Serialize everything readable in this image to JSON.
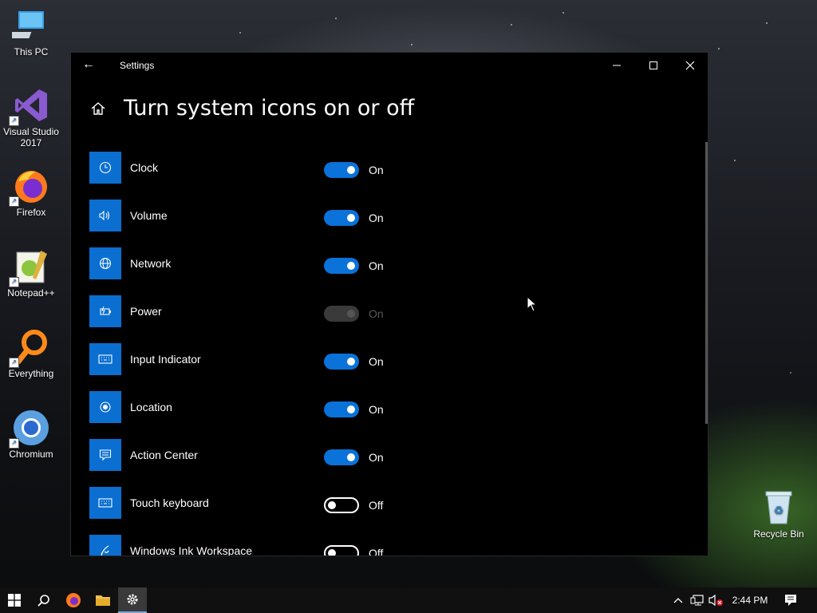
{
  "desktop": {
    "icons": [
      {
        "label": "This PC",
        "icon": "this-pc-icon"
      },
      {
        "label": "Visual Studio 2017",
        "icon": "visual-studio-icon"
      },
      {
        "label": "Firefox",
        "icon": "firefox-icon"
      },
      {
        "label": "Notepad++",
        "icon": "notepad-plus-plus-icon"
      },
      {
        "label": "Everything",
        "icon": "everything-search-icon"
      },
      {
        "label": "Chromium",
        "icon": "chromium-icon"
      }
    ],
    "recycle_bin": {
      "label": "Recycle Bin",
      "icon": "recycle-bin-icon"
    }
  },
  "window": {
    "title": "Settings",
    "page_title": "Turn system icons on or off",
    "settings": [
      {
        "name": "Clock",
        "icon": "clock-icon",
        "state": "On",
        "on": true,
        "enabled": true
      },
      {
        "name": "Volume",
        "icon": "volume-icon",
        "state": "On",
        "on": true,
        "enabled": true
      },
      {
        "name": "Network",
        "icon": "network-globe-icon",
        "state": "On",
        "on": true,
        "enabled": true
      },
      {
        "name": "Power",
        "icon": "battery-icon",
        "state": "On",
        "on": true,
        "enabled": false
      },
      {
        "name": "Input Indicator",
        "icon": "keyboard-icon",
        "state": "On",
        "on": true,
        "enabled": true
      },
      {
        "name": "Location",
        "icon": "location-icon",
        "state": "On",
        "on": true,
        "enabled": true
      },
      {
        "name": "Action Center",
        "icon": "action-center-icon",
        "state": "On",
        "on": true,
        "enabled": true
      },
      {
        "name": "Touch keyboard",
        "icon": "keyboard-icon",
        "state": "Off",
        "on": false,
        "enabled": true
      },
      {
        "name": "Windows Ink Workspace",
        "icon": "pen-icon",
        "state": "Off",
        "on": false,
        "enabled": true
      }
    ]
  },
  "taskbar": {
    "clock": "2:44 PM",
    "pinned": [
      "start-icon",
      "search-icon",
      "firefox-icon",
      "file-explorer-icon",
      "settings-gear-icon"
    ]
  },
  "colors": {
    "accent": "#0a72d8",
    "tile": "#0a6fd0",
    "window_bg": "#000000"
  }
}
